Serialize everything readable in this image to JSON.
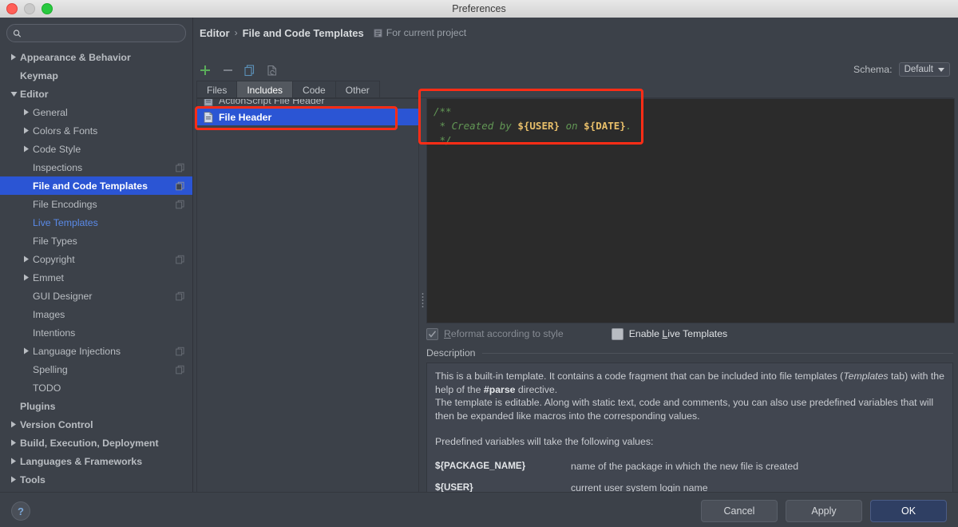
{
  "window": {
    "title": "Preferences"
  },
  "sidebar": {
    "search": {
      "value": "",
      "placeholder": ""
    },
    "items": [
      {
        "label": "Appearance & Behavior",
        "level": 0,
        "arrow": "right",
        "bold": true,
        "copy": false
      },
      {
        "label": "Keymap",
        "level": 0,
        "arrow": "none",
        "bold": true,
        "copy": false
      },
      {
        "label": "Editor",
        "level": 0,
        "arrow": "down",
        "bold": true,
        "copy": false
      },
      {
        "label": "General",
        "level": 1,
        "arrow": "right",
        "bold": false,
        "copy": false
      },
      {
        "label": "Colors & Fonts",
        "level": 1,
        "arrow": "right",
        "bold": false,
        "copy": false
      },
      {
        "label": "Code Style",
        "level": 1,
        "arrow": "right",
        "bold": false,
        "copy": false
      },
      {
        "label": "Inspections",
        "level": 1,
        "arrow": "none",
        "bold": false,
        "copy": true
      },
      {
        "label": "File and Code Templates",
        "level": 1,
        "arrow": "none",
        "bold": true,
        "copy": true,
        "selected": true
      },
      {
        "label": "File Encodings",
        "level": 1,
        "arrow": "none",
        "bold": false,
        "copy": true
      },
      {
        "label": "Live Templates",
        "level": 1,
        "arrow": "none",
        "bold": false,
        "copy": false,
        "modified": true
      },
      {
        "label": "File Types",
        "level": 1,
        "arrow": "none",
        "bold": false,
        "copy": false
      },
      {
        "label": "Copyright",
        "level": 1,
        "arrow": "right",
        "bold": false,
        "copy": true
      },
      {
        "label": "Emmet",
        "level": 1,
        "arrow": "right",
        "bold": false,
        "copy": false
      },
      {
        "label": "GUI Designer",
        "level": 1,
        "arrow": "none",
        "bold": false,
        "copy": true
      },
      {
        "label": "Images",
        "level": 1,
        "arrow": "none",
        "bold": false,
        "copy": false
      },
      {
        "label": "Intentions",
        "level": 1,
        "arrow": "none",
        "bold": false,
        "copy": false
      },
      {
        "label": "Language Injections",
        "level": 1,
        "arrow": "right",
        "bold": false,
        "copy": true
      },
      {
        "label": "Spelling",
        "level": 1,
        "arrow": "none",
        "bold": false,
        "copy": true
      },
      {
        "label": "TODO",
        "level": 1,
        "arrow": "none",
        "bold": false,
        "copy": false
      },
      {
        "label": "Plugins",
        "level": 0,
        "arrow": "none",
        "bold": true,
        "copy": false
      },
      {
        "label": "Version Control",
        "level": 0,
        "arrow": "right",
        "bold": true,
        "copy": false
      },
      {
        "label": "Build, Execution, Deployment",
        "level": 0,
        "arrow": "right",
        "bold": true,
        "copy": false
      },
      {
        "label": "Languages & Frameworks",
        "level": 0,
        "arrow": "right",
        "bold": true,
        "copy": false
      },
      {
        "label": "Tools",
        "level": 0,
        "arrow": "right",
        "bold": true,
        "copy": false
      }
    ]
  },
  "breadcrumb": {
    "root": "Editor",
    "separator": "›",
    "current": "File and Code Templates",
    "scope": "For current project"
  },
  "toolbar": {
    "add_title": "+",
    "remove_title": "−",
    "copy_title": "Copy Template",
    "reset_title": "Reset To Default"
  },
  "schema": {
    "label": "Schema:",
    "value": "Default"
  },
  "tabs": [
    {
      "label": "Files",
      "active": false
    },
    {
      "label": "Includes",
      "active": true
    },
    {
      "label": "Code",
      "active": false
    },
    {
      "label": "Other",
      "active": false
    }
  ],
  "template_list": [
    {
      "label": "ActionScript File Header",
      "selected": false,
      "clipped": true
    },
    {
      "label": "File Header",
      "selected": true,
      "clipped": false
    }
  ],
  "editor": {
    "line1": "/**",
    "line2_pre": " * Created by ",
    "line2_var1": "${USER}",
    "line2_mid": " on ",
    "line2_var2": "${DATE}",
    "line2_post": ".",
    "line3": " */"
  },
  "options": {
    "reformat": {
      "label": "Reformat according to style",
      "checked": true,
      "enabled": false
    },
    "live_templates": {
      "label": "Enable Live Templates",
      "checked": false,
      "enabled": true
    }
  },
  "description": {
    "header": "Description",
    "p1_a": "This is a built-in template. It contains a code fragment that can be included into file templates (",
    "p1_i": "Templates",
    "p1_b": " tab) with the help of the ",
    "p1_bold": "#parse",
    "p1_c": " directive.",
    "p2": "The template is editable. Along with static text, code and comments, you can also use predefined variables that will then be expanded like macros into the corresponding values.",
    "p3": "Predefined variables will take the following values:",
    "variables": [
      {
        "name": "${PACKAGE_NAME}",
        "desc": "name of the package in which the new file is created"
      },
      {
        "name": "${USER}",
        "desc": "current user system login name"
      }
    ]
  },
  "footer": {
    "help": "?",
    "cancel": "Cancel",
    "apply": "Apply",
    "ok": "OK"
  },
  "colors": {
    "accent_selection": "#2b55d4",
    "annotation": "#ff2d16",
    "comment_green": "#629755",
    "variable_orange": "#e8bf6a",
    "add_green": "#5aac5a",
    "modified_blue": "#5a8ae8"
  }
}
